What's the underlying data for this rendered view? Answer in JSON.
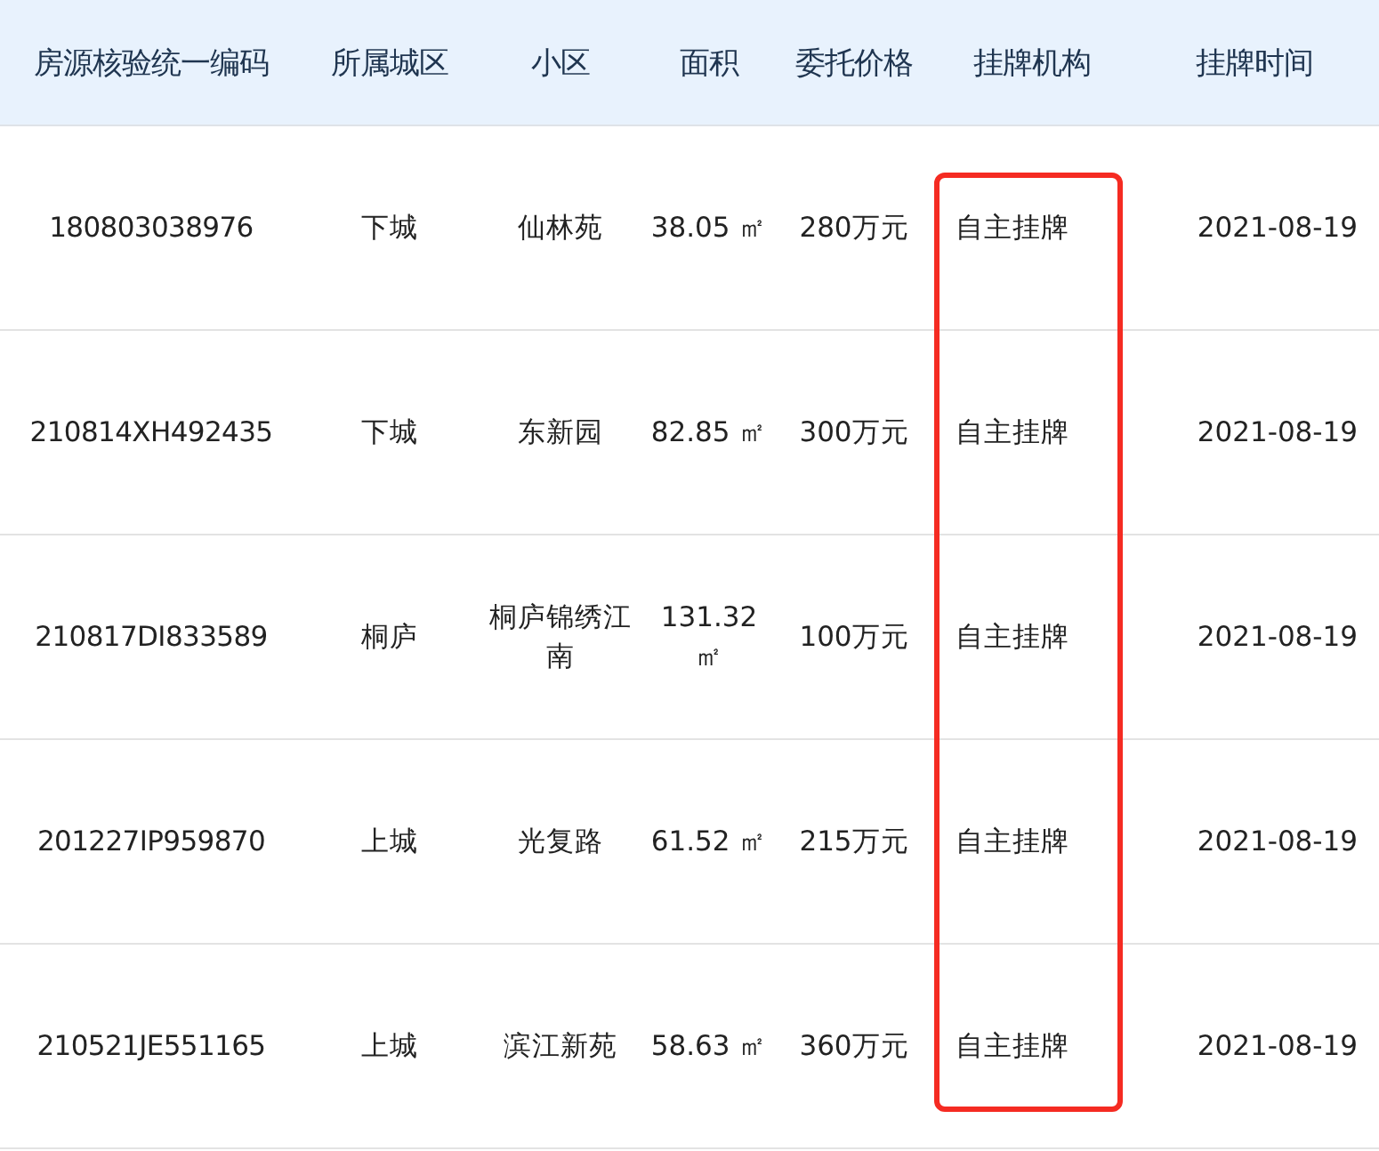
{
  "table": {
    "columns": [
      "房源核验统一编码",
      "所属城区",
      "小区",
      "面积",
      "委托价格",
      "挂牌机构",
      "挂牌时间"
    ],
    "rows": [
      {
        "cells": [
          "180803038976",
          "下城",
          "仙林苑",
          "38.05 ㎡",
          "280万元",
          "自主挂牌",
          "2021-08-19"
        ]
      },
      {
        "cells": [
          "210814XH492435",
          "下城",
          "东新园",
          "82.85 ㎡",
          "300万元",
          "自主挂牌",
          "2021-08-19"
        ]
      },
      {
        "cells": [
          "210817DI833589",
          "桐庐",
          "桐庐锦绣江南",
          "131.32 ㎡",
          "100万元",
          "自主挂牌",
          "2021-08-19"
        ]
      },
      {
        "cells": [
          "201227IP959870",
          "上城",
          "光复路",
          "61.52 ㎡",
          "215万元",
          "自主挂牌",
          "2021-08-19"
        ]
      },
      {
        "cells": [
          "210521JE551165",
          "上城",
          "滨江新苑",
          "58.63 ㎡",
          "360万元",
          "自主挂牌",
          "2021-08-19"
        ]
      }
    ]
  }
}
